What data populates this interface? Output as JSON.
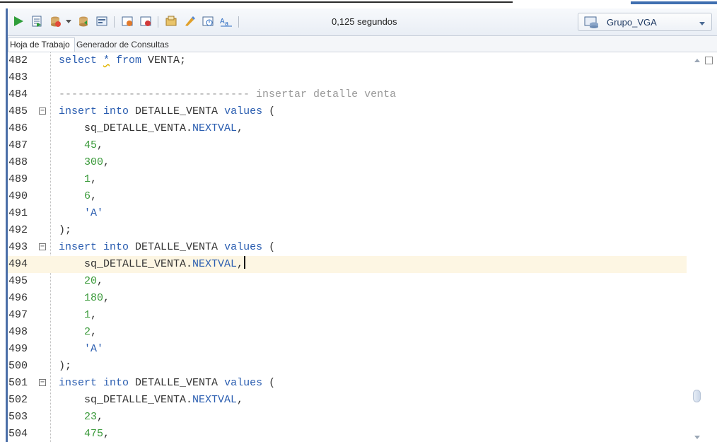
{
  "toolbar": {
    "timing": "0,125 segundos",
    "connection": "Grupo_VGA",
    "icons": [
      "run-statement-icon",
      "run-script-icon",
      "commit-icon",
      "dropdown-arrow-icon",
      "rollback-icon",
      "explain-plan-icon",
      "autotrace-icon",
      "sql-tuning-icon",
      "unshared-sql-icon",
      "clear-icon",
      "history-icon",
      "format-case-icon"
    ]
  },
  "tabs": [
    {
      "label": "Hoja de Trabajo"
    },
    {
      "label": "Generador de Consultas"
    }
  ],
  "editor": {
    "highlighted_line": "494",
    "lines": [
      {
        "n": "482",
        "t": [
          [
            "k",
            "select "
          ],
          [
            "s",
            "*"
          ],
          [
            "k",
            " from "
          ],
          [
            "p",
            "VENTA;"
          ]
        ]
      },
      {
        "n": "483",
        "t": []
      },
      {
        "n": "484",
        "t": [
          [
            "c",
            "------------------------------ insertar detalle venta"
          ]
        ]
      },
      {
        "n": "485",
        "fold": true,
        "t": [
          [
            "k",
            "insert into "
          ],
          [
            "p",
            "DETALLE_VENTA "
          ],
          [
            "k",
            "values "
          ],
          [
            "p",
            "("
          ]
        ]
      },
      {
        "n": "486",
        "t": [
          [
            "p",
            "    sq_DETALLE_VENTA."
          ],
          [
            "k",
            "NEXTVAL"
          ],
          [
            "p",
            ","
          ]
        ]
      },
      {
        "n": "487",
        "t": [
          [
            "p",
            "    "
          ],
          [
            "g",
            "45"
          ],
          [
            "p",
            ","
          ]
        ]
      },
      {
        "n": "488",
        "t": [
          [
            "p",
            "    "
          ],
          [
            "g",
            "300"
          ],
          [
            "p",
            ","
          ]
        ]
      },
      {
        "n": "489",
        "t": [
          [
            "p",
            "    "
          ],
          [
            "g",
            "1"
          ],
          [
            "p",
            ","
          ]
        ]
      },
      {
        "n": "490",
        "t": [
          [
            "p",
            "    "
          ],
          [
            "g",
            "6"
          ],
          [
            "p",
            ","
          ]
        ]
      },
      {
        "n": "491",
        "t": [
          [
            "p",
            "    "
          ],
          [
            "q",
            "'A'"
          ]
        ]
      },
      {
        "n": "492",
        "t": [
          [
            "p",
            ");"
          ]
        ]
      },
      {
        "n": "493",
        "fold": true,
        "t": [
          [
            "k",
            "insert into "
          ],
          [
            "p",
            "DETALLE_VENTA "
          ],
          [
            "k",
            "values "
          ],
          [
            "p",
            "("
          ]
        ]
      },
      {
        "n": "494",
        "caret": true,
        "t": [
          [
            "p",
            "    sq_DETALLE_VENTA."
          ],
          [
            "k",
            "NEXTVAL"
          ],
          [
            "p",
            ","
          ]
        ]
      },
      {
        "n": "495",
        "t": [
          [
            "p",
            "    "
          ],
          [
            "g",
            "20"
          ],
          [
            "p",
            ","
          ]
        ]
      },
      {
        "n": "496",
        "t": [
          [
            "p",
            "    "
          ],
          [
            "g",
            "180"
          ],
          [
            "p",
            ","
          ]
        ]
      },
      {
        "n": "497",
        "t": [
          [
            "p",
            "    "
          ],
          [
            "g",
            "1"
          ],
          [
            "p",
            ","
          ]
        ]
      },
      {
        "n": "498",
        "t": [
          [
            "p",
            "    "
          ],
          [
            "g",
            "2"
          ],
          [
            "p",
            ","
          ]
        ]
      },
      {
        "n": "499",
        "t": [
          [
            "p",
            "    "
          ],
          [
            "q",
            "'A'"
          ]
        ]
      },
      {
        "n": "500",
        "t": [
          [
            "p",
            ");"
          ]
        ]
      },
      {
        "n": "501",
        "fold": true,
        "t": [
          [
            "k",
            "insert into "
          ],
          [
            "p",
            "DETALLE_VENTA "
          ],
          [
            "k",
            "values "
          ],
          [
            "p",
            "("
          ]
        ]
      },
      {
        "n": "502",
        "t": [
          [
            "p",
            "    sq_DETALLE_VENTA."
          ],
          [
            "k",
            "NEXTVAL"
          ],
          [
            "p",
            ","
          ]
        ]
      },
      {
        "n": "503",
        "t": [
          [
            "p",
            "    "
          ],
          [
            "g",
            "23"
          ],
          [
            "p",
            ","
          ]
        ]
      },
      {
        "n": "504",
        "t": [
          [
            "p",
            "    "
          ],
          [
            "g",
            "475"
          ],
          [
            "p",
            ","
          ]
        ]
      }
    ]
  }
}
